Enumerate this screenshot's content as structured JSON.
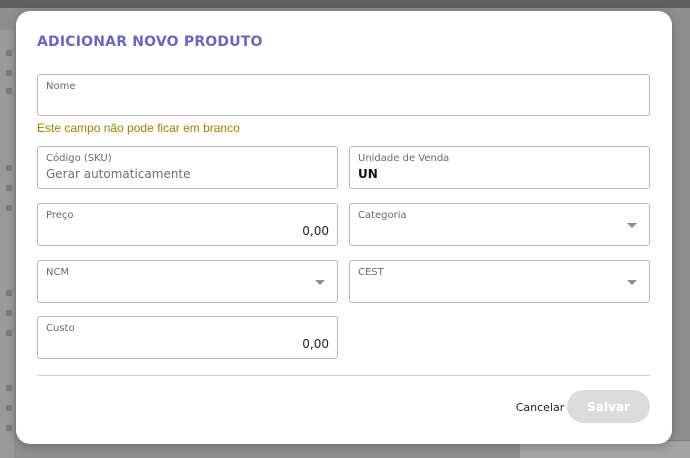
{
  "modal": {
    "title": "ADICIONAR NOVO PRODUTO",
    "fields": {
      "nome": {
        "label": "Nome",
        "value": ""
      },
      "nome_error": "Este campo não pode ficar em branco",
      "codigo": {
        "label": "Código (SKU)",
        "placeholder": "Gerar automaticamente"
      },
      "unidade": {
        "label": "Unidade de Venda",
        "value": "UN"
      },
      "preco": {
        "label": "Preço",
        "value": "0,00"
      },
      "categoria": {
        "label": "Categoria",
        "value": ""
      },
      "ncm": {
        "label": "NCM",
        "value": ""
      },
      "cest": {
        "label": "CEST",
        "value": ""
      },
      "custo": {
        "label": "Custo",
        "value": "0,00"
      }
    },
    "actions": {
      "cancel_label": "Cancelar",
      "save_label": "Salvar"
    }
  },
  "colors": {
    "title": "#6b68b8",
    "error": "#a07f00",
    "save_disabled_bg": "#dcdcdc",
    "overlay": "#8f8f8f"
  },
  "icons": {
    "select_caret": "chevron-down-icon"
  }
}
